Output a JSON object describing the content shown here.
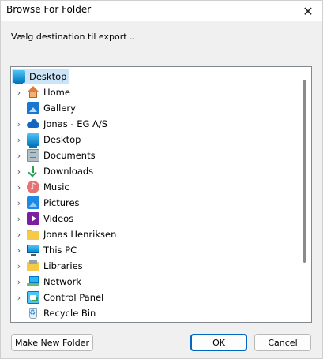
{
  "window": {
    "title": "Browse For Folder",
    "close_glyph": "✕"
  },
  "instruction": "Vælg destination til export ..",
  "tree": {
    "root": {
      "label": "Desktop",
      "icon": "desktop-icon"
    },
    "items": [
      {
        "label": "Home",
        "icon": "home-icon",
        "expandable": true
      },
      {
        "label": "Gallery",
        "icon": "gallery-icon",
        "expandable": false
      },
      {
        "label": "Jonas - EG A/S",
        "icon": "onedrive-cloud-icon",
        "expandable": true
      },
      {
        "label": "Desktop",
        "icon": "desktop-icon",
        "expandable": true
      },
      {
        "label": "Documents",
        "icon": "documents-icon",
        "expandable": true
      },
      {
        "label": "Downloads",
        "icon": "downloads-icon",
        "expandable": true
      },
      {
        "label": "Music",
        "icon": "music-icon",
        "expandable": true
      },
      {
        "label": "Pictures",
        "icon": "pictures-icon",
        "expandable": true
      },
      {
        "label": "Videos",
        "icon": "videos-icon",
        "expandable": true
      },
      {
        "label": "Jonas Henriksen",
        "icon": "user-folder-icon",
        "expandable": true
      },
      {
        "label": "This PC",
        "icon": "this-pc-icon",
        "expandable": true
      },
      {
        "label": "Libraries",
        "icon": "libraries-icon",
        "expandable": true
      },
      {
        "label": "Network",
        "icon": "network-icon",
        "expandable": true
      },
      {
        "label": "Control Panel",
        "icon": "control-panel-icon",
        "expandable": true
      },
      {
        "label": "Recycle Bin",
        "icon": "recycle-bin-icon",
        "expandable": false
      }
    ]
  },
  "buttons": {
    "new_folder": "Make New Folder",
    "ok": "OK",
    "cancel": "Cancel"
  },
  "colors": {
    "selection": "#cce4f7",
    "accent": "#0067c0"
  }
}
